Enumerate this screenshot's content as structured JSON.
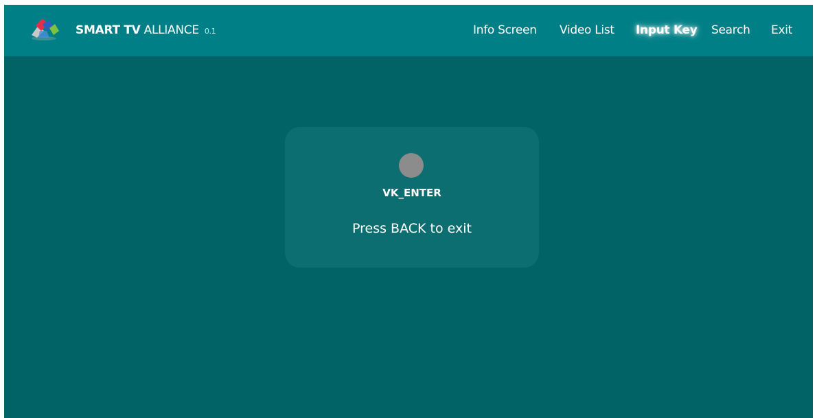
{
  "header": {
    "brand_bold": "SMART TV",
    "brand_light": "ALLIANCE",
    "version": "0.1",
    "nav": [
      {
        "label": "Info Screen",
        "active": false
      },
      {
        "label": "Video List",
        "active": false
      },
      {
        "label": "Input Key",
        "active": true
      },
      {
        "label": "Search",
        "active": false
      },
      {
        "label": "Exit",
        "active": false
      }
    ]
  },
  "main": {
    "key_name": "VK_ENTER",
    "hint": "Press BACK to exit"
  },
  "colors": {
    "topbar": "#017F86",
    "background": "#016366",
    "panel": "#0C6E70",
    "indicator": "#8C8C8C"
  }
}
